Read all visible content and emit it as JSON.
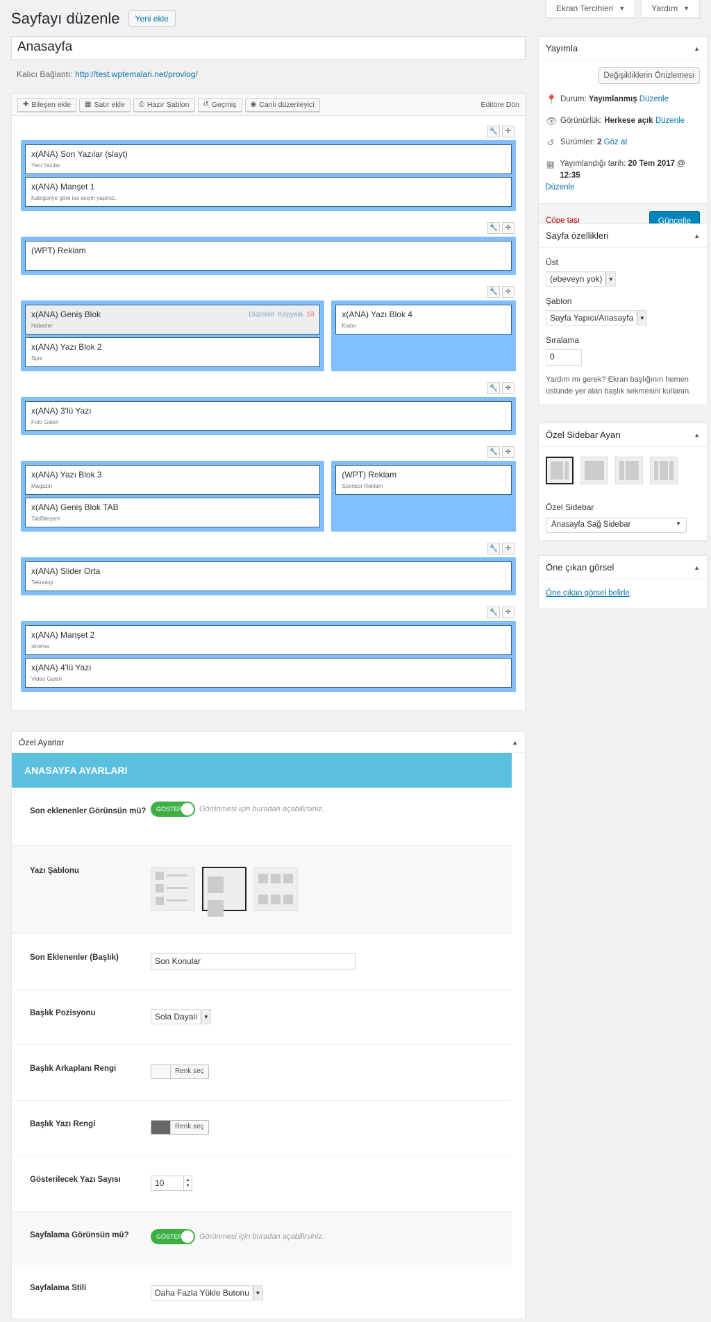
{
  "screen_options": {
    "prefs": "Ekran Tercihleri",
    "help": "Yardım"
  },
  "header": {
    "title": "Sayfayı düzenle",
    "add_new": "Yeni ekle"
  },
  "post": {
    "title": "Anasayfa",
    "permalink_label": "Kalıcı Bağlantı:",
    "permalink_url": "http://test.wptemalari.net/provlog/"
  },
  "toolbar": {
    "add_component": "Bileşen ekle",
    "add_row": "Satır ekle",
    "ready_template": "Hazır Şablon",
    "history": "Geçmiş",
    "live_editor": "Canlı düzenleyici",
    "back_to_editor": "Editöre Dön"
  },
  "widget_actions": {
    "edit": "Düzenle",
    "copy": "Kopyala",
    "delete": "Sil"
  },
  "rows": [
    {
      "cols": [
        [
          {
            "title": "x(ANA) Son Yazılar (slayt)",
            "sub": "Yeni Yazılar"
          },
          {
            "title": "x(ANA) Manşet 1",
            "sub": "Kategoriye göre ise seçim yapınız.."
          }
        ]
      ]
    },
    {
      "cols": [
        [
          {
            "title": "(WPT) Reklam",
            "sub": ""
          }
        ]
      ]
    },
    {
      "cols": [
        [
          {
            "title": "x(ANA) Geniş Blok",
            "sub": "Haberler"
          },
          {
            "title": "x(ANA) Yazı Blok 2",
            "sub": "Spor"
          }
        ],
        [
          {
            "title": "x(ANA) Yazı Blok 4",
            "sub": "Kadın"
          }
        ]
      ]
    },
    {
      "cols": [
        [
          {
            "title": "x(ANA) 3'lü Yazı",
            "sub": "Foto Galeri"
          }
        ]
      ]
    },
    {
      "cols": [
        [
          {
            "title": "x(ANA) Yazı Blok 3",
            "sub": "Magazin"
          },
          {
            "title": "x(ANA) Geniş Blok TAB",
            "sub": "TabBileşeni"
          }
        ],
        [
          {
            "title": "(WPT) Reklam",
            "sub": "Sponsor Reklam"
          }
        ]
      ]
    },
    {
      "cols": [
        [
          {
            "title": "x(ANA) Slider Orta",
            "sub": "Teknoloji"
          }
        ]
      ]
    },
    {
      "cols": [
        [
          {
            "title": "x(ANA) Manşet 2",
            "sub": "sinema"
          },
          {
            "title": "x(ANA) 4'lü Yazı",
            "sub": "Video Galeri"
          }
        ]
      ]
    }
  ],
  "publish": {
    "title": "Yayımla",
    "preview": "Değişikliklerin Önizlemesi",
    "status_label": "Durum:",
    "status_value": "Yayımlanmış",
    "edit": "Düzenle",
    "visibility_label": "Görünürlük:",
    "visibility_value": "Herkese açık",
    "revisions_label": "Sürümler:",
    "revisions_value": "2",
    "browse": "Göz at",
    "published_label": "Yayımlandığı tarih:",
    "published_value": "20 Tem 2017 @ 12:35",
    "trash": "Çöpe taşı",
    "update": "Güncelle"
  },
  "page_attrs": {
    "title": "Sayfa özellikleri",
    "parent_label": "Üst",
    "parent_value": "(ebeveyn yok)",
    "template_label": "Şablon",
    "template_value": "Sayfa Yapıcı/Anasayfa",
    "order_label": "Sıralama",
    "order_value": "0",
    "help": "Yardım mı gerek? Ekran başlığının hemen üstünde yer alan başlık sekmesini kullanın."
  },
  "sidebar_setting": {
    "title": "Özel Sidebar Ayarı",
    "sidebar_label": "Özel Sidebar",
    "sidebar_value": "Anasayfa Sağ Sidebar"
  },
  "featured": {
    "title": "Öne çıkan görsel",
    "link": "Öne çıkan görsel belirle"
  },
  "custom": {
    "title": "Özel Ayarlar",
    "banner": "ANASAYFA AYARLARI",
    "recent_visible_label": "Son eklenenler Görünsün mü?",
    "toggle_text": "GÖSTER",
    "toggle_hint": "Görünmesi için buradan açabilirsiniz.",
    "post_template_label": "Yazı Şablonu",
    "recent_title_label": "Son Eklenenler (Başlık)",
    "recent_title_value": "Son Konular",
    "title_pos_label": "Başlık Pozisyonu",
    "title_pos_value": "Sola Dayalı",
    "title_bg_label": "Başlık Arkaplanı Rengi",
    "title_text_color_label": "Başlık Yazı Rengi",
    "pick_color": "Renk seç",
    "title_bg_color": "#f9f9f9",
    "title_text_color": "#666666",
    "count_label": "Gösterilecek Yazı Sayısı",
    "count_value": "10",
    "pagination_visible_label": "Sayfalama Görünsün mü?",
    "pagination_style_label": "Sayfalama Stili",
    "pagination_style_value": "Daha Fazla Yükle Butonu"
  }
}
